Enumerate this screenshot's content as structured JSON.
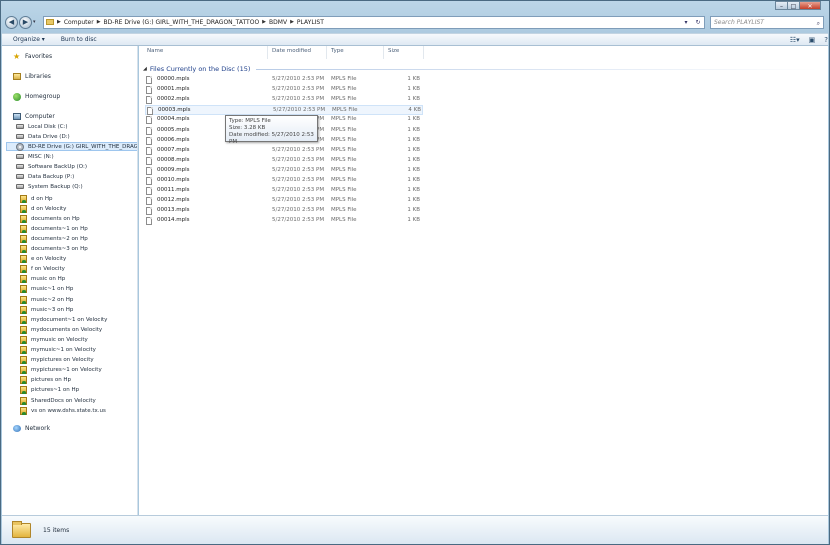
{
  "window": {
    "caption": {
      "minimize": "–",
      "maximize": "□",
      "close": "✕"
    }
  },
  "address": {
    "crumbs": [
      "Computer",
      "BD-RE Drive (G:) GIRL_WITH_THE_DRAGON_TATTOO",
      "BDMV",
      "PLAYLIST"
    ],
    "search_placeholder": "Search PLAYLIST"
  },
  "toolbar": {
    "organize": "Organize ▾",
    "burn": "Burn to disc"
  },
  "sidebar": {
    "favorites": "Favorites",
    "libraries": "Libraries",
    "homegroup": "Homegroup",
    "computer": "Computer",
    "drives": [
      {
        "label": "Local Disk (C:)",
        "icon": "disk"
      },
      {
        "label": "Data Drive (D:)",
        "icon": "disk"
      },
      {
        "label": "BD-RE Drive (G:) GIRL_WITH_THE_DRAGON_TATTOO",
        "icon": "disc",
        "selected": true
      },
      {
        "label": "MISC (N:)",
        "icon": "disk"
      },
      {
        "label": "Software BackUp (O:)",
        "icon": "disk"
      },
      {
        "label": "Data Backup (P:)",
        "icon": "disk"
      },
      {
        "label": "System Backup (Q:)",
        "icon": "disk"
      }
    ],
    "shares": [
      "d on Hp",
      "d on Velocity",
      "documents on Hp",
      "documents~1 on Hp",
      "documents~2 on Hp",
      "documents~3 on Hp",
      "e on Velocity",
      "f on Velocity",
      "music on Hp",
      "music~1 on Hp",
      "music~2 on Hp",
      "music~3 on Hp",
      "mydocument~1 on Velocity",
      "mydocuments on Velocity",
      "mymusic on Velocity",
      "mymusic~1 on Velocity",
      "mypictures on Velocity",
      "mypictures~1 on Velocity",
      "pictures on Hp",
      "pictures~1 on Hp",
      "SharedDocs on Velocity",
      "vs on www.dshs.state.tx.us"
    ],
    "network": "Network"
  },
  "columns": {
    "name": "Name",
    "date": "Date modified",
    "type": "Type",
    "size": "Size"
  },
  "group_label": "Files Currently on the Disc (15)",
  "files": [
    {
      "name": "00000.mpls",
      "date": "5/27/2010 2:53 PM",
      "type": "MPLS File",
      "size": "1 KB"
    },
    {
      "name": "00001.mpls",
      "date": "5/27/2010 2:53 PM",
      "type": "MPLS File",
      "size": "1 KB"
    },
    {
      "name": "00002.mpls",
      "date": "5/27/2010 2:53 PM",
      "type": "MPLS File",
      "size": "1 KB"
    },
    {
      "name": "00003.mpls",
      "date": "5/27/2010 2:53 PM",
      "type": "MPLS File",
      "size": "4 KB"
    },
    {
      "name": "00004.mpls",
      "date": "5/27/2010 2:53 PM",
      "type": "MPLS File",
      "size": "1 KB"
    },
    {
      "name": "00005.mpls",
      "date": "5/27/2010 2:53 PM",
      "type": "MPLS File",
      "size": "1 KB"
    },
    {
      "name": "00006.mpls",
      "date": "5/27/2010 2:53 PM",
      "type": "MPLS File",
      "size": "1 KB"
    },
    {
      "name": "00007.mpls",
      "date": "5/27/2010 2:53 PM",
      "type": "MPLS File",
      "size": "1 KB"
    },
    {
      "name": "00008.mpls",
      "date": "5/27/2010 2:53 PM",
      "type": "MPLS File",
      "size": "1 KB"
    },
    {
      "name": "00009.mpls",
      "date": "5/27/2010 2:53 PM",
      "type": "MPLS File",
      "size": "1 KB"
    },
    {
      "name": "00010.mpls",
      "date": "5/27/2010 2:53 PM",
      "type": "MPLS File",
      "size": "1 KB"
    },
    {
      "name": "00011.mpls",
      "date": "5/27/2010 2:53 PM",
      "type": "MPLS File",
      "size": "1 KB"
    },
    {
      "name": "00012.mpls",
      "date": "5/27/2010 2:53 PM",
      "type": "MPLS File",
      "size": "1 KB"
    },
    {
      "name": "00013.mpls",
      "date": "5/27/2010 2:53 PM",
      "type": "MPLS File",
      "size": "1 KB"
    },
    {
      "name": "00014.mpls",
      "date": "5/27/2010 2:53 PM",
      "type": "MPLS File",
      "size": "1 KB"
    }
  ],
  "hovered_file_index": 3,
  "tooltip": {
    "type": "Type: MPLS File",
    "size": "Size: 3.28 KB",
    "date": "Date modified: 5/27/2010 2:53 PM"
  },
  "status": {
    "count": "15 items"
  },
  "colors": {
    "accent": "#1e3f8a",
    "window_frame": "#a9c7dd",
    "selection": "#dcecfc"
  }
}
